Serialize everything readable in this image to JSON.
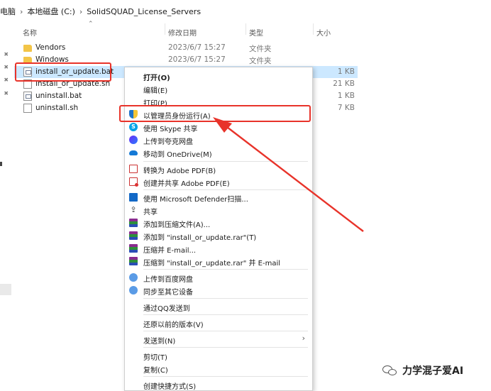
{
  "breadcrumb": {
    "items": [
      "电脑",
      "本地磁盘 (C:)",
      "SolidSQUAD_License_Servers"
    ],
    "separator": "›"
  },
  "columns": {
    "name": "名称",
    "modified": "修改日期",
    "type": "类型",
    "size": "大小"
  },
  "files": [
    {
      "name": "Vendors",
      "modified": "2023/6/7 15:27",
      "type": "文件夹",
      "size": "",
      "icon": "folder-icon"
    },
    {
      "name": "Windows",
      "modified": "2023/6/7 15:27",
      "type": "文件夹",
      "size": "",
      "icon": "folder-icon"
    },
    {
      "name": "install_or_update.bat",
      "modified": "",
      "type": "",
      "size": "1 KB",
      "icon": "bat-file-icon",
      "selected": true
    },
    {
      "name": "install_or_update.sh",
      "modified": "",
      "type": "",
      "size": "21 KB",
      "icon": "file-icon"
    },
    {
      "name": "uninstall.bat",
      "modified": "",
      "type": "",
      "size": "1 KB",
      "icon": "bat-file-icon"
    },
    {
      "name": "uninstall.sh",
      "modified": "",
      "type": "",
      "size": "7 KB",
      "icon": "file-icon"
    }
  ],
  "context_menu": {
    "items": [
      {
        "label": "打开(O)",
        "bold": true
      },
      {
        "label": "编辑(E)"
      },
      {
        "label": "打印(P)"
      },
      {
        "label": "以管理员身份运行(A)",
        "icon": "uac-shield-icon",
        "highlighted": true
      },
      {
        "label": "使用 Skype 共享",
        "icon": "skype-icon"
      },
      {
        "label": "上传到夸克网盘",
        "icon": "quark-icon"
      },
      {
        "label": "移动到 OneDrive(M)",
        "icon": "onedrive-icon"
      },
      {
        "label": "转换为 Adobe PDF(B)",
        "icon": "adobe-pdf-icon"
      },
      {
        "label": "创建并共享 Adobe PDF(E)",
        "icon": "adobe-pdf-share-icon"
      },
      {
        "label": "使用 Microsoft Defender扫描...",
        "icon": "defender-icon"
      },
      {
        "label": "共享",
        "icon": "share-icon"
      },
      {
        "label": "添加到压缩文件(A)...",
        "icon": "winrar-icon"
      },
      {
        "label": "添加到 \"install_or_update.rar\"(T)",
        "icon": "winrar-icon"
      },
      {
        "label": "压缩并 E-mail...",
        "icon": "winrar-icon"
      },
      {
        "label": "压缩到 \"install_or_update.rar\" 并 E-mail",
        "icon": "winrar-icon"
      },
      {
        "label": "上传到百度网盘",
        "icon": "baidu-cloud-icon"
      },
      {
        "label": "同步至其它设备",
        "icon": "baidu-sync-icon"
      },
      {
        "label": "通过QQ发送到"
      },
      {
        "label": "还原以前的版本(V)"
      },
      {
        "label": "发送到(N)",
        "submenu": true
      },
      {
        "label": "剪切(T)"
      },
      {
        "label": "复制(C)"
      },
      {
        "label": "创建快捷方式(S)"
      }
    ]
  },
  "watermark": {
    "text": "力学混子爱AI",
    "icon": "wechat-icon"
  },
  "colors": {
    "highlight": "#e8332a",
    "selection": "#cce8ff",
    "folder": "#f3c547"
  }
}
